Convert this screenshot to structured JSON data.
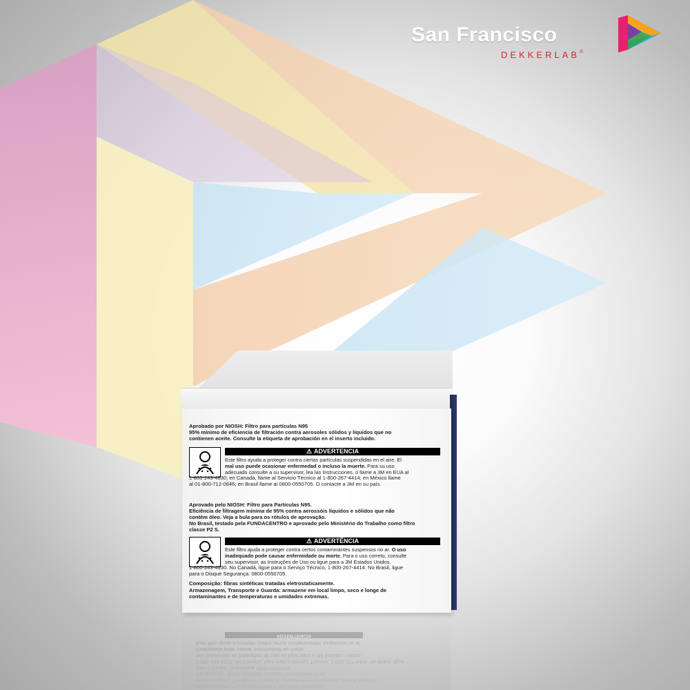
{
  "brand": {
    "name": "San Francisco",
    "sub": "DEKKERLAB",
    "reg": "®",
    "colors": {
      "sub": "#d7262a",
      "logo": [
        "#e8206f",
        "#f6a21b",
        "#2bb2e6",
        "#7b3fa0"
      ]
    }
  },
  "background_logo": {
    "icon": "play-triangle-logo",
    "colors": [
      "#f2a6c8",
      "#f8efb4",
      "#f9d9b3",
      "#c9e6f7"
    ]
  },
  "box": {
    "es": {
      "approval": "Aprobado por NIOSH: Filtro para partículas N95",
      "efficiency": "95% mínimo de eficiencia de filtración contra aerosoles sólidos y líquidos que no",
      "efficiency2": "contienen aceite. Consulte la etiqueta de aprobación en el inserto incluido.",
      "warning_title": "ADVERTENCIA",
      "warning_l1": "Este filtro ayuda a proteger contra ciertas partículas suspendidas en el aire. El",
      "warning_l2": "mal uso puede ocasionar enfermedad o incluso la muerte.",
      "warning_l2b": " Para su uso",
      "warning_l3": "adecuado consulte a su supervisor, lea las Instrucciones, o llame a 3M en EUA al",
      "warning_l4": "1-800-243-4630; en Canadá, llame al Servicio Técnico al 1-800-267-4414; en México llame",
      "warning_l5": "al 01-800-712-0646; en Brasil llame al 0800-0550705. O contacte a 3M en su país."
    },
    "pt": {
      "approval": "Aprovado pelo NIOSH: Filtro para Partículas N95.",
      "efficiency": "Eficiência de filtragem mínima de 95% contra aerossóis líquidos e sólidos que não",
      "efficiency2": "contém óleo. Veja a bula para os rótulos de aprovação.",
      "brazil": "No Brasil, testado pela FUNDACENTRO e aprovado pelo Ministério do Trabalho como filtro",
      "brazil2": "classe P2 S.",
      "warning_title": "ADVERTÊNCIA",
      "warning_l1": "Este filtro ajuda a proteger contra certos contaminantes suspensos no ar.",
      "warning_l1b": " O uso",
      "warning_l2": "inadequado pode causar enfermidade ou morte.",
      "warning_l2b": " Para o uso correto, consulte",
      "warning_l3": "seu supervisor, as Instruções de Uso ou ligue para a 3M Estados Unidos,",
      "warning_l4": "1-800-243-4630. No Canadá, ligue para o Serviço Técnico, 1-800-267-4414. No Brasil, ligue",
      "warning_l5": "para o Disque Segurança: 0800-0550705.",
      "composition": "Composição: fibras sintéticas tratadas eletrostaticamente.",
      "storage": "Armazenagem, Transporte e Guarda: armazene em local limpo, seco e longe de",
      "storage2": "contaminantes e de temperaturas e umidades extremas."
    }
  }
}
